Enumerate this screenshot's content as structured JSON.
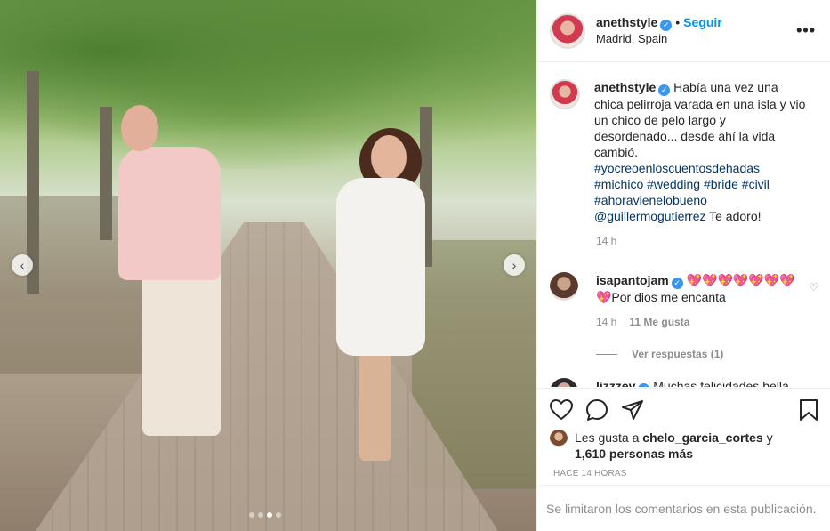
{
  "post": {
    "username": "anethstyle",
    "follow_label": "Seguir",
    "location": "Madrid, Spain",
    "more_label": "•••",
    "verified_icon": "✓",
    "separator": "•"
  },
  "caption": {
    "username": "anethstyle",
    "text": " Había una vez una chica pelirroja varada en una isla y vio un chico de pelo largo y desordenado... desde ahí la vida cambió. ",
    "hashtags": [
      "#yocreoenloscuentosdehadas",
      "#michico",
      "#wedding",
      "#bride",
      "#civil",
      "#ahoravienelobueno"
    ],
    "mention": "@guillermogutierrez",
    "tail": " Te adoro!",
    "time": "14 h"
  },
  "comments": [
    {
      "username": "isapantojam",
      "text": " 💖💖💖💖💖💖💖💖Por dios me encanta",
      "time": "14 h",
      "likes": "11 Me gusta",
      "replies": "Ver respuestas (1)"
    },
    {
      "username": "lizzzev",
      "text": " Muchas felicidades bella"
    }
  ],
  "likes": {
    "prefix": "Les gusta a ",
    "user": "chelo_garcia_cortes",
    "middle": " y ",
    "count": "1,610 personas más"
  },
  "timestamp": "HACE 14 HORAS",
  "comments_closed": "Se limitaron los comentarios en esta publicación.",
  "carousel": {
    "prev": "‹",
    "next": "›",
    "dots": 4,
    "active_dot": 2
  },
  "colors": {
    "accent": "#0095f6",
    "verified": "#3897f0",
    "hashtag": "#00376b"
  }
}
